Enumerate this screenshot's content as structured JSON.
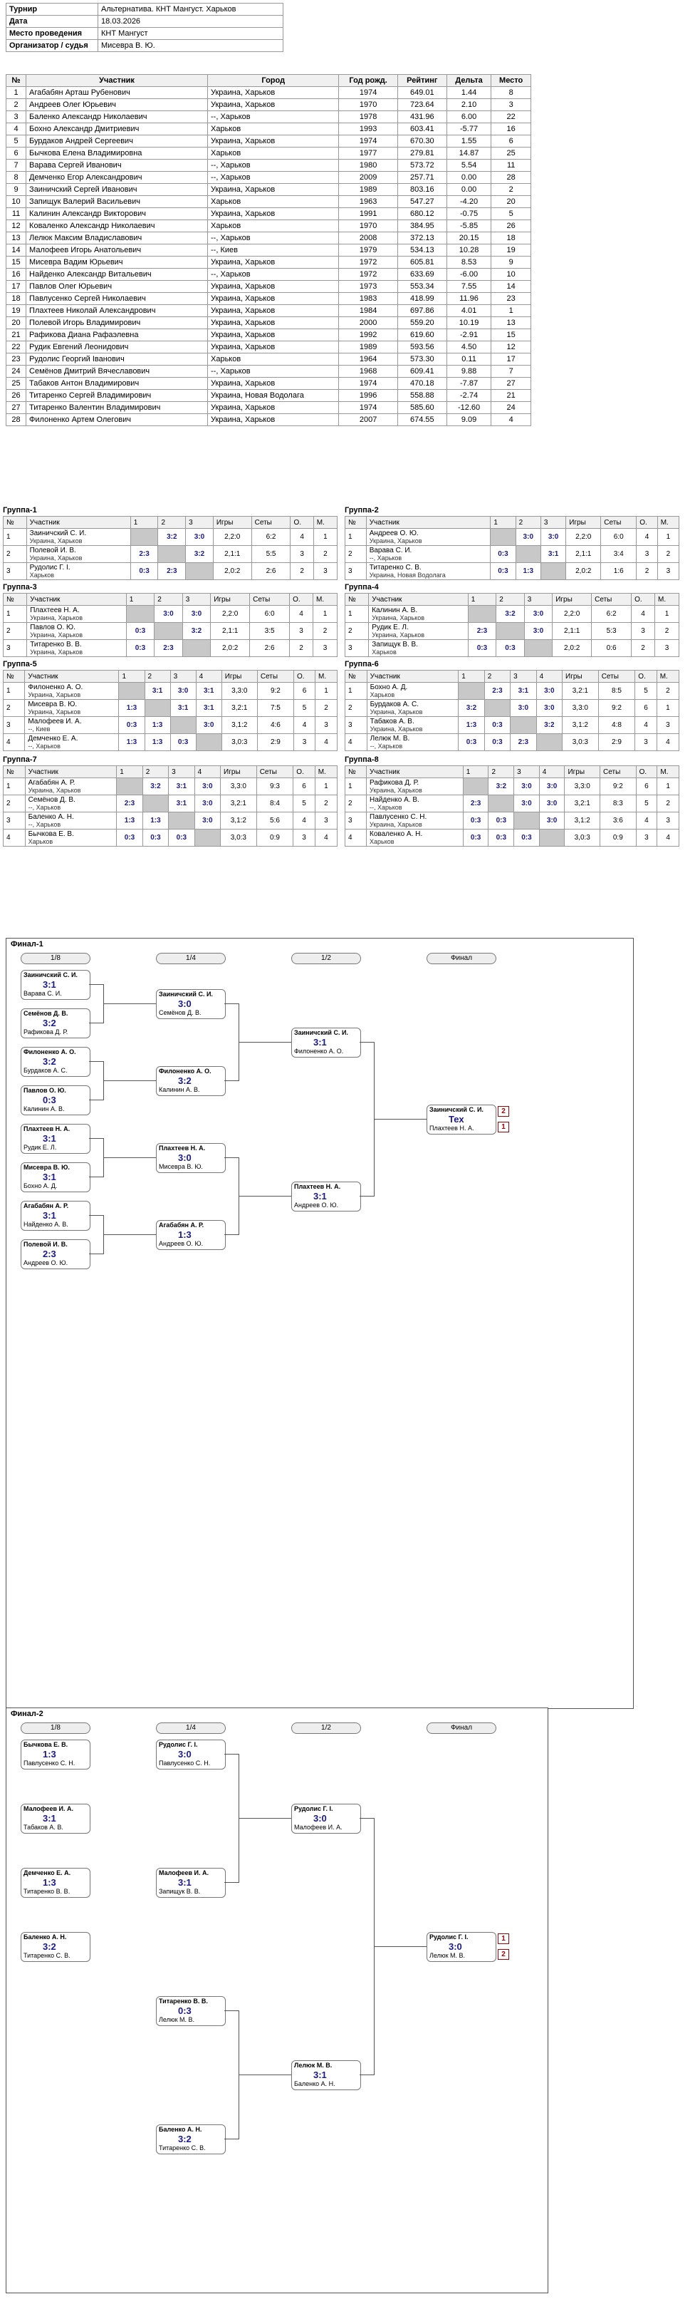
{
  "header": {
    "tournament_label": "Турнир",
    "tournament_value": "Альтернатива. КНТ Мангуст. Харьков",
    "date_label": "Дата",
    "date_value": "18.03.2026",
    "place_label": "Место проведения",
    "place_value": "КНТ Мангуст",
    "org_label": "Организатор / судья",
    "org_value": "Мисевра В. Ю."
  },
  "players_table": {
    "columns": [
      "№",
      "Участник",
      "Город",
      "Год рожд.",
      "Рейтинг",
      "Дельта",
      "Место"
    ],
    "rows": [
      [
        "1",
        "Агабабян Арташ Рубенович",
        "Украина, Харьков",
        "1974",
        "649.01",
        "1.44",
        "8"
      ],
      [
        "2",
        "Андреев Олег Юрьевич",
        "Украина, Харьков",
        "1970",
        "723.64",
        "2.10",
        "3"
      ],
      [
        "3",
        "Баленко Александр Николаевич",
        "--, Харьков",
        "1978",
        "431.96",
        "6.00",
        "22"
      ],
      [
        "4",
        "Бохно Александр Дмитриевич",
        "Харьков",
        "1993",
        "603.41",
        "-5.77",
        "16"
      ],
      [
        "5",
        "Бурдаков Андрей Сергеевич",
        "Украина, Харьков",
        "1974",
        "670.30",
        "1.55",
        "6"
      ],
      [
        "6",
        "Бычкова Елена Владимировна",
        "Харьков",
        "1977",
        "279.81",
        "14.87",
        "25"
      ],
      [
        "7",
        "Варава Сергей Иванович",
        "--, Харьков",
        "1980",
        "573.72",
        "5.54",
        "11"
      ],
      [
        "8",
        "Демченко Егор Александрович",
        "--, Харьков",
        "2009",
        "257.71",
        "0.00",
        "28"
      ],
      [
        "9",
        "Заиничский Сергей Иванович",
        "Украина, Харьков",
        "1989",
        "803.16",
        "0.00",
        "2"
      ],
      [
        "10",
        "Запищук Валерий Васильевич",
        "Харьков",
        "1963",
        "547.27",
        "-4.20",
        "20"
      ],
      [
        "11",
        "Калинин Александр Викторович",
        "Украина, Харьков",
        "1991",
        "680.12",
        "-0.75",
        "5"
      ],
      [
        "12",
        "Коваленко Александр Николаевич",
        "Харьков",
        "1970",
        "384.95",
        "-5.85",
        "26"
      ],
      [
        "13",
        "Лелюк Максим Владиславович",
        "--, Харьков",
        "2008",
        "372.13",
        "20.15",
        "18"
      ],
      [
        "14",
        "Малофеев Игорь Анатольевич",
        "--, Киев",
        "1979",
        "534.13",
        "10.28",
        "19"
      ],
      [
        "15",
        "Мисевра Вадим Юрьевич",
        "Украина, Харьков",
        "1972",
        "605.81",
        "8.53",
        "9"
      ],
      [
        "16",
        "Найденко Александр Витальевич",
        "--, Харьков",
        "1972",
        "633.69",
        "-6.00",
        "10"
      ],
      [
        "17",
        "Павлов Олег Юрьевич",
        "Украина, Харьков",
        "1973",
        "553.34",
        "7.55",
        "14"
      ],
      [
        "18",
        "Павлусенко Сергей Николаевич",
        "Украина, Харьков",
        "1983",
        "418.99",
        "11.96",
        "23"
      ],
      [
        "19",
        "Плахтеев Николай Александрович",
        "Украина, Харьков",
        "1984",
        "697.86",
        "4.01",
        "1"
      ],
      [
        "20",
        "Полевой Игорь Владимирович",
        "Украина, Харьков",
        "2000",
        "559.20",
        "10.19",
        "13"
      ],
      [
        "21",
        "Рафикова Диана Рафаэлевна",
        "Украина, Харьков",
        "1992",
        "619.60",
        "-2.91",
        "15"
      ],
      [
        "22",
        "Рудик Евгений Леонидович",
        "Украина, Харьков",
        "1989",
        "593.56",
        "4.50",
        "12"
      ],
      [
        "23",
        "Рудолис Георгий Іванович",
        "Харьков",
        "1964",
        "573.30",
        "0.11",
        "17"
      ],
      [
        "24",
        "Семёнов Дмитрий Вячеславович",
        "--, Харьков",
        "1968",
        "609.41",
        "9.88",
        "7"
      ],
      [
        "25",
        "Табаков Антон Владимирович",
        "Украина, Харьков",
        "1974",
        "470.18",
        "-7.87",
        "27"
      ],
      [
        "26",
        "Титаренко Сергей Владимирович",
        "Украина, Новая Водолага",
        "1996",
        "558.88",
        "-2.74",
        "21"
      ],
      [
        "27",
        "Титаренко Валентин Владимирович",
        "Украина, Харьков",
        "1974",
        "585.60",
        "-12.60",
        "24"
      ],
      [
        "28",
        "Филоненко Артем Олегович",
        "Украина, Харьков",
        "2007",
        "674.55",
        "9.09",
        "4"
      ]
    ]
  },
  "groups": [
    {
      "title": "Группа-1",
      "cols": [
        "№",
        "Участник",
        "1",
        "2",
        "3",
        "Игры",
        "Сеты",
        "О.",
        "М."
      ],
      "rows": [
        [
          "1",
          "Заиничский С. И.",
          "Украина, Харьков",
          "",
          "3:2",
          "3:0",
          "2,2:0",
          "6:2",
          "4",
          "1"
        ],
        [
          "2",
          "Полевой И. В.",
          "Украина, Харьков",
          "2:3",
          "",
          "3:2",
          "2,1:1",
          "5:5",
          "3",
          "2"
        ],
        [
          "3",
          "Рудолис Г. І.",
          "Харьков",
          "0:3",
          "2:3",
          "",
          "2,0:2",
          "2:6",
          "2",
          "3"
        ]
      ]
    },
    {
      "title": "Группа-2",
      "cols": [
        "№",
        "Участник",
        "1",
        "2",
        "3",
        "Игры",
        "Сеты",
        "О.",
        "М."
      ],
      "rows": [
        [
          "1",
          "Андреев О. Ю.",
          "Украина, Харьков",
          "",
          "3:0",
          "3:0",
          "2,2:0",
          "6:0",
          "4",
          "1"
        ],
        [
          "2",
          "Варава С. И.",
          "--, Харьков",
          "0:3",
          "",
          "3:1",
          "2,1:1",
          "3:4",
          "3",
          "2"
        ],
        [
          "3",
          "Титаренко С. В.",
          "Украина, Новая Водолага",
          "0:3",
          "1:3",
          "",
          "2,0:2",
          "1:6",
          "2",
          "3"
        ]
      ]
    },
    {
      "title": "Группа-3",
      "cols": [
        "№",
        "Участник",
        "1",
        "2",
        "3",
        "Игры",
        "Сеты",
        "О.",
        "М."
      ],
      "rows": [
        [
          "1",
          "Плахтеев Н. А.",
          "Украина, Харьков",
          "",
          "3:0",
          "3:0",
          "2,2:0",
          "6:0",
          "4",
          "1"
        ],
        [
          "2",
          "Павлов О. Ю.",
          "Украина, Харьков",
          "0:3",
          "",
          "3:2",
          "2,1:1",
          "3:5",
          "3",
          "2"
        ],
        [
          "3",
          "Титаренко В. В.",
          "Украина, Харьков",
          "0:3",
          "2:3",
          "",
          "2,0:2",
          "2:6",
          "2",
          "3"
        ]
      ]
    },
    {
      "title": "Группа-4",
      "cols": [
        "№",
        "Участник",
        "1",
        "2",
        "3",
        "Игры",
        "Сеты",
        "О.",
        "М."
      ],
      "rows": [
        [
          "1",
          "Калинин А. В.",
          "Украина, Харьков",
          "",
          "3:2",
          "3:0",
          "2,2:0",
          "6:2",
          "4",
          "1"
        ],
        [
          "2",
          "Рудик Е. Л.",
          "Украина, Харьков",
          "2:3",
          "",
          "3:0",
          "2,1:1",
          "5:3",
          "3",
          "2"
        ],
        [
          "3",
          "Запищук В. В.",
          "Харьков",
          "0:3",
          "0:3",
          "",
          "2,0:2",
          "0:6",
          "2",
          "3"
        ]
      ]
    },
    {
      "title": "Группа-5",
      "cols": [
        "№",
        "Участник",
        "1",
        "2",
        "3",
        "4",
        "Игры",
        "Сеты",
        "О.",
        "М."
      ],
      "rows": [
        [
          "1",
          "Филоненко А. О.",
          "Украина, Харьков",
          "",
          "3:1",
          "3:0",
          "3:1",
          "3,3:0",
          "9:2",
          "6",
          "1"
        ],
        [
          "2",
          "Мисевра В. Ю.",
          "Украина, Харьков",
          "1:3",
          "",
          "3:1",
          "3:1",
          "3,2:1",
          "7:5",
          "5",
          "2"
        ],
        [
          "3",
          "Малофеев И. А.",
          "--, Киев",
          "0:3",
          "1:3",
          "",
          "3:0",
          "3,1:2",
          "4:6",
          "4",
          "3"
        ],
        [
          "4",
          "Демченко Е. А.",
          "--, Харьков",
          "1:3",
          "1:3",
          "0:3",
          "",
          "3,0:3",
          "2:9",
          "3",
          "4"
        ]
      ]
    },
    {
      "title": "Группа-6",
      "cols": [
        "№",
        "Участник",
        "1",
        "2",
        "3",
        "4",
        "Игры",
        "Сеты",
        "О.",
        "М."
      ],
      "rows": [
        [
          "1",
          "Бохно А. Д.",
          "Харьков",
          "",
          "2:3",
          "3:1",
          "3:0",
          "3,2:1",
          "8:5",
          "5",
          "2"
        ],
        [
          "2",
          "Бурдаков А. С.",
          "Украина, Харьков",
          "3:2",
          "",
          "3:0",
          "3:0",
          "3,3:0",
          "9:2",
          "6",
          "1"
        ],
        [
          "3",
          "Табаков А. В.",
          "Украина, Харьков",
          "1:3",
          "0:3",
          "",
          "3:2",
          "3,1:2",
          "4:8",
          "4",
          "3"
        ],
        [
          "4",
          "Лелюк М. В.",
          "--, Харьков",
          "0:3",
          "0:3",
          "2:3",
          "",
          "3,0:3",
          "2:9",
          "3",
          "4"
        ]
      ]
    },
    {
      "title": "Группа-7",
      "cols": [
        "№",
        "Участник",
        "1",
        "2",
        "3",
        "4",
        "Игры",
        "Сеты",
        "О.",
        "М."
      ],
      "rows": [
        [
          "1",
          "Агабабян А. Р.",
          "Украина, Харьков",
          "",
          "3:2",
          "3:1",
          "3:0",
          "3,3:0",
          "9:3",
          "6",
          "1"
        ],
        [
          "2",
          "Семёнов Д. В.",
          "--, Харьков",
          "2:3",
          "",
          "3:1",
          "3:0",
          "3,2:1",
          "8:4",
          "5",
          "2"
        ],
        [
          "3",
          "Баленко А. Н.",
          "--, Харьков",
          "1:3",
          "1:3",
          "",
          "3:0",
          "3,1:2",
          "5:6",
          "4",
          "3"
        ],
        [
          "4",
          "Бычкова Е. В.",
          "Харьков",
          "0:3",
          "0:3",
          "0:3",
          "",
          "3,0:3",
          "0:9",
          "3",
          "4"
        ]
      ]
    },
    {
      "title": "Группа-8",
      "cols": [
        "№",
        "Участник",
        "1",
        "2",
        "3",
        "4",
        "Игры",
        "Сеты",
        "О.",
        "М."
      ],
      "rows": [
        [
          "1",
          "Рафикова Д. Р.",
          "Украина, Харьков",
          "",
          "3:2",
          "3:0",
          "3:0",
          "3,3:0",
          "9:2",
          "6",
          "1"
        ],
        [
          "2",
          "Найденко А. В.",
          "--, Харьков",
          "2:3",
          "",
          "3:0",
          "3:0",
          "3,2:1",
          "8:3",
          "5",
          "2"
        ],
        [
          "3",
          "Павлусенко С. Н.",
          "Украина, Харьков",
          "0:3",
          "0:3",
          "",
          "3:0",
          "3,1:2",
          "3:6",
          "4",
          "3"
        ],
        [
          "4",
          "Коваленко А. Н.",
          "Харьков",
          "0:3",
          "0:3",
          "0:3",
          "",
          "3,0:3",
          "0:9",
          "3",
          "4"
        ]
      ]
    }
  ],
  "final1": {
    "title": "Финал-1",
    "rounds": [
      "1/8",
      "1/4",
      "1/2",
      "Финал"
    ],
    "r1": [
      [
        "Заиничский С. И.",
        "Варава С. И.",
        "3:1"
      ],
      [
        "Семёнов Д. В.",
        "Рафикова Д. Р.",
        "3:2"
      ],
      [
        "Филоненко А. О.",
        "Бурдаков А. С.",
        "3:2"
      ],
      [
        "Павлов О. Ю.",
        "Калинин А. В.",
        "0:3"
      ],
      [
        "Плахтеев Н. А.",
        "Рудик Е. Л.",
        "3:1"
      ],
      [
        "Мисевра В. Ю.",
        "Бохно А. Д.",
        "3:1"
      ],
      [
        "Агабабян А. Р.",
        "Найденко А. В.",
        "3:1"
      ],
      [
        "Полевой И. В.",
        "Андреев О. Ю.",
        "2:3"
      ]
    ],
    "r2": [
      [
        "Заиничский С. И.",
        "Семёнов Д. В.",
        "3:0"
      ],
      [
        "Филоненко А. О.",
        "Калинин А. В.",
        "3:2"
      ],
      [
        "Плахтеев Н. А.",
        "Мисевра В. Ю.",
        "3:0"
      ],
      [
        "Агабабян А. Р.",
        "Андреев О. Ю.",
        "1:3"
      ]
    ],
    "r3": [
      [
        "Заиничский С. И.",
        "Филоненко А. О.",
        "3:1"
      ],
      [
        "Плахтеев Н. А.",
        "Андреев О. Ю.",
        "3:1"
      ]
    ],
    "final": [
      "Заиничский С. И.",
      "Плахтеев Н. А.",
      "Тех"
    ],
    "places": [
      "2",
      "1"
    ]
  },
  "final2": {
    "title": "Финал-2",
    "rounds": [
      "1/8",
      "1/4",
      "1/2",
      "Финал"
    ],
    "r1": [
      [
        "Бычкова Е. В.",
        "Павлусенко С. Н.",
        "1:3"
      ],
      [
        "Малофеев И. А.",
        "Табаков А. В.",
        "3:1"
      ],
      [
        "Демченко Е. А.",
        "Титаренко В. В.",
        "1:3"
      ],
      [
        "Баленко А. Н.",
        "Титаренко С. В.",
        "3:2"
      ]
    ],
    "r2": [
      [
        "Рудолис Г. І.",
        "Павлусенко С. Н.",
        "3:0"
      ],
      [
        "Малофеев И. А.",
        "Запищук В. В.",
        "3:1"
      ],
      [
        "Титаренко В. В.",
        "Лелюк М. В.",
        "0:3"
      ],
      [
        "Баленко А. Н.",
        "Титаренко С. В.",
        "3:2"
      ]
    ],
    "r3": [
      [
        "Рудолис Г. І.",
        "Малофеев И. А.",
        "3:0"
      ],
      [
        "Лелюк М. В.",
        "Баленко А. Н.",
        "3:1"
      ]
    ],
    "final": [
      "Рудолис Г. І.",
      "Лелюк М. В.",
      "3:0"
    ],
    "places": [
      "1",
      "2"
    ]
  }
}
